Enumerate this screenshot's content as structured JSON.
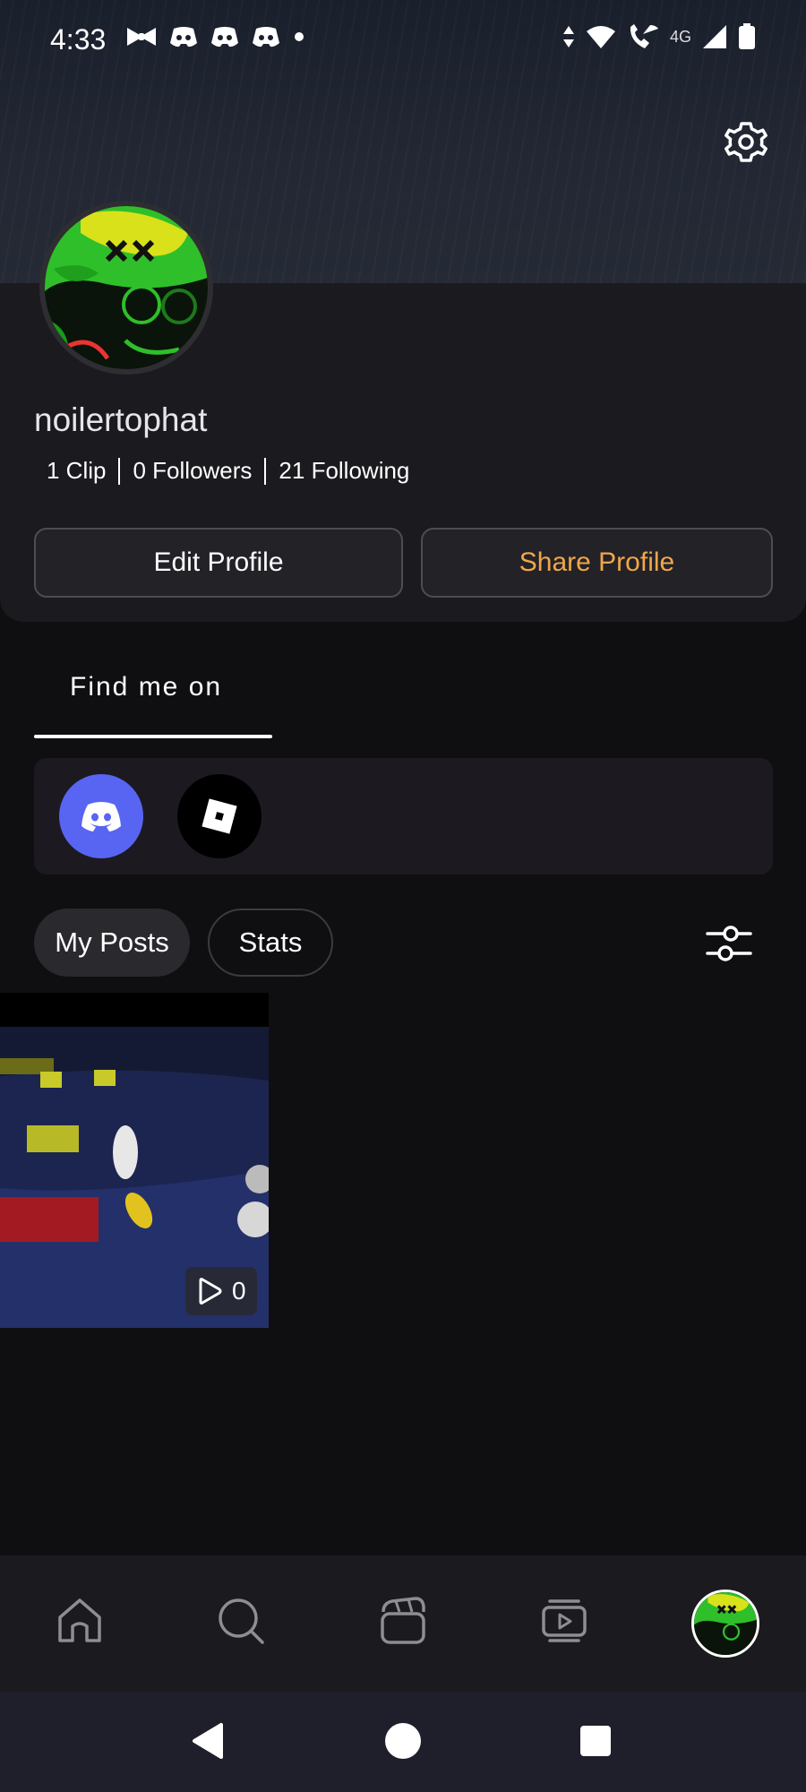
{
  "status_bar": {
    "time": "4:33",
    "network": "4G",
    "left_icons": [
      "bowtie-icon",
      "discord-icon",
      "discord-icon",
      "discord-icon",
      "dot-icon"
    ],
    "right_icons": [
      "data-arrows-icon",
      "wifi-icon",
      "wifi-call-icon",
      "signal-icon",
      "battery-icon"
    ]
  },
  "profile": {
    "username": "noilertophat",
    "stats": {
      "clips": "1 Clip",
      "followers": "0 Followers",
      "following": "21 Following"
    },
    "edit_button": "Edit Profile",
    "share_button": "Share Profile"
  },
  "find_me": {
    "tab_label": "Find me on",
    "socials": [
      "discord-icon",
      "roblox-icon"
    ]
  },
  "content_tabs": {
    "my_posts": "My Posts",
    "stats": "Stats"
  },
  "posts": [
    {
      "views": "0"
    }
  ],
  "bottom_nav": [
    "home-icon",
    "search-icon",
    "clapper-icon",
    "video-library-icon",
    "profile-avatar"
  ],
  "system_nav": [
    "back-icon",
    "home-circle-icon",
    "recents-icon"
  ],
  "colors": {
    "accent_share": "#f0a64a",
    "discord": "#5865f2",
    "background": "#0f0f11",
    "card": "#1b1a1f"
  }
}
